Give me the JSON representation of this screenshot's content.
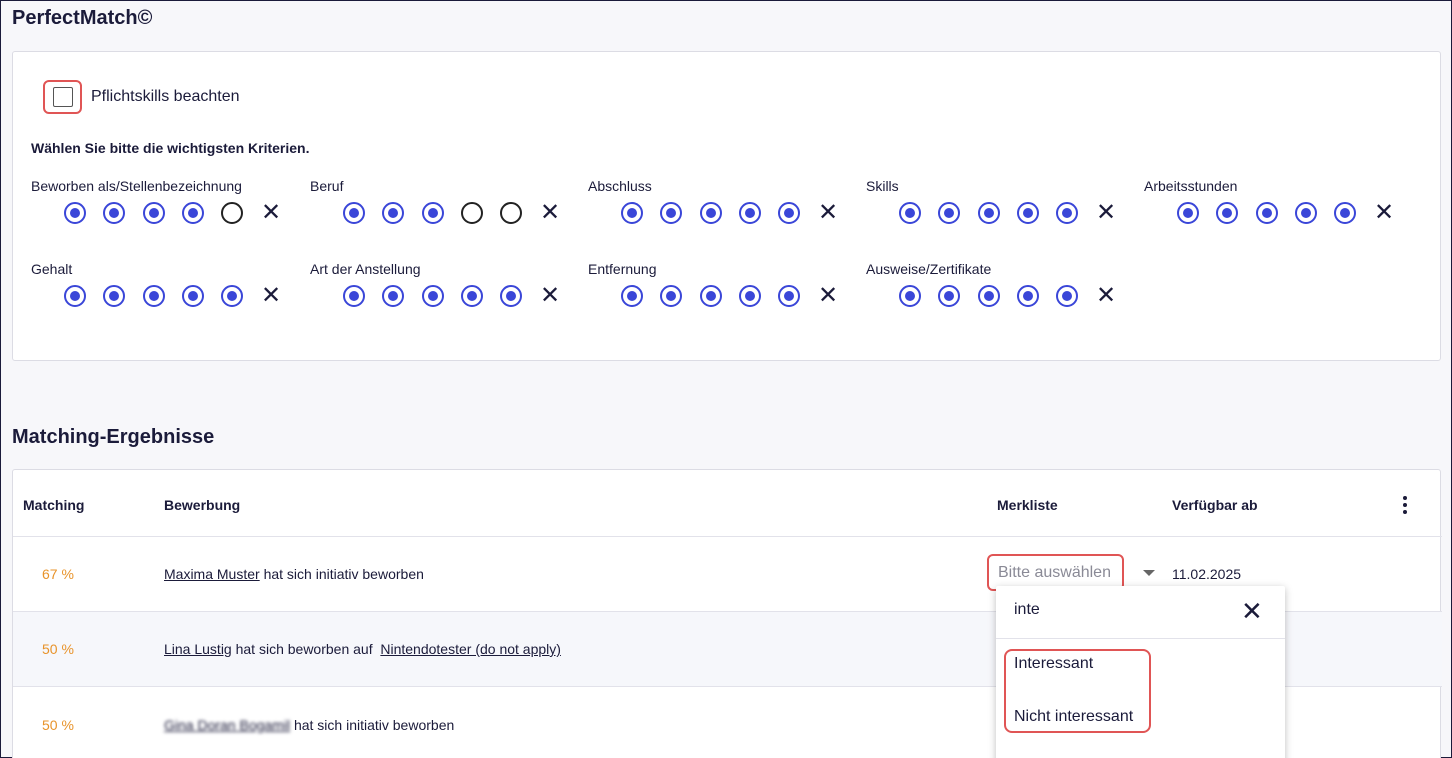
{
  "page": {
    "title": "PerfectMatch©",
    "results_title": "Matching-Ergebnisse"
  },
  "criteria": {
    "checkbox_label": "Pflichtskills beachten",
    "prompt": "Wählen Sie bitte die wichtigsten Kriterien.",
    "items": [
      {
        "name": "Beworben als/Stellenbezeichnung",
        "level": 4
      },
      {
        "name": "Beruf",
        "level": 3
      },
      {
        "name": "Abschluss",
        "level": 5
      },
      {
        "name": "Skills",
        "level": 5
      },
      {
        "name": "Arbeitsstunden",
        "level": 5
      },
      {
        "name": "Gehalt",
        "level": 5
      },
      {
        "name": "Art der Anstellung",
        "level": 5
      },
      {
        "name": "Entfernung",
        "level": 5
      },
      {
        "name": "Ausweise/Zertifikate",
        "level": 5
      }
    ],
    "max_level": 5,
    "remove_glyph": "✕"
  },
  "table": {
    "headers": {
      "matching": "Matching",
      "bewerbung": "Bewerbung",
      "merkliste": "Merkliste",
      "verfuegbar": "Verfügbar ab"
    },
    "rows": [
      {
        "pct": "67 %",
        "name": "Maxima Muster",
        "text": " hat sich initiativ beworben",
        "job": "",
        "date": "11.02.2025"
      },
      {
        "pct": "50 %",
        "name": "Lina Lustig",
        "text": " hat sich beworben auf ",
        "job": "Nintendotester (do not apply)",
        "date": ""
      },
      {
        "pct": "50 %",
        "name": "Gina Doran Bogamil",
        "text": " hat sich initiativ beworben",
        "job": "",
        "date": ""
      }
    ],
    "select_placeholder": "Bitte auswählen"
  },
  "dropdown": {
    "search_value": "inte",
    "close_glyph": "✕",
    "options": [
      "Interessant",
      "Nicht interessant"
    ]
  },
  "colors": {
    "accent": "#3a46d8",
    "percent": "#e8932a",
    "highlight": "#e05555"
  }
}
